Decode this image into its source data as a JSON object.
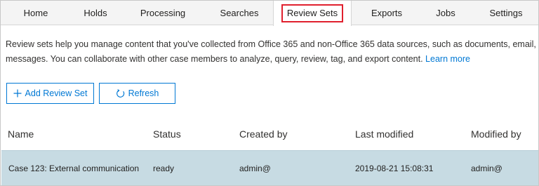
{
  "tabs": [
    {
      "label": "Home",
      "active": false
    },
    {
      "label": "Holds",
      "active": false
    },
    {
      "label": "Processing",
      "active": false
    },
    {
      "label": "Searches",
      "active": false
    },
    {
      "label": "Review Sets",
      "active": true
    },
    {
      "label": "Exports",
      "active": false
    },
    {
      "label": "Jobs",
      "active": false
    },
    {
      "label": "Settings",
      "active": false
    }
  ],
  "description": {
    "line1": "Review sets help you manage content that you've collected from Office 365 and non-Office 365 data sources, such as documents, email,",
    "line2": "messages. You can collaborate with other case members to analyze, query, review, tag, and export content.",
    "learn_more": "Learn more"
  },
  "toolbar": {
    "add_label": "Add Review Set",
    "add_icon": "plus-icon",
    "refresh_label": "Refresh",
    "refresh_icon": "refresh-icon"
  },
  "table": {
    "columns": [
      "Name",
      "Status",
      "Created by",
      "Last modified",
      "Modified by"
    ],
    "rows": [
      {
        "name": "Case 123: External communication",
        "status": "ready",
        "created_by": "admin@",
        "last_modified": "2019-08-21 15:08:31",
        "modified_by": "admin@",
        "selected": true
      }
    ]
  },
  "colors": {
    "accent": "#0078d4",
    "highlight_border": "#e0202e",
    "selected_row": "#c7dbe3",
    "tabbar_bg": "#f4f4f4"
  }
}
